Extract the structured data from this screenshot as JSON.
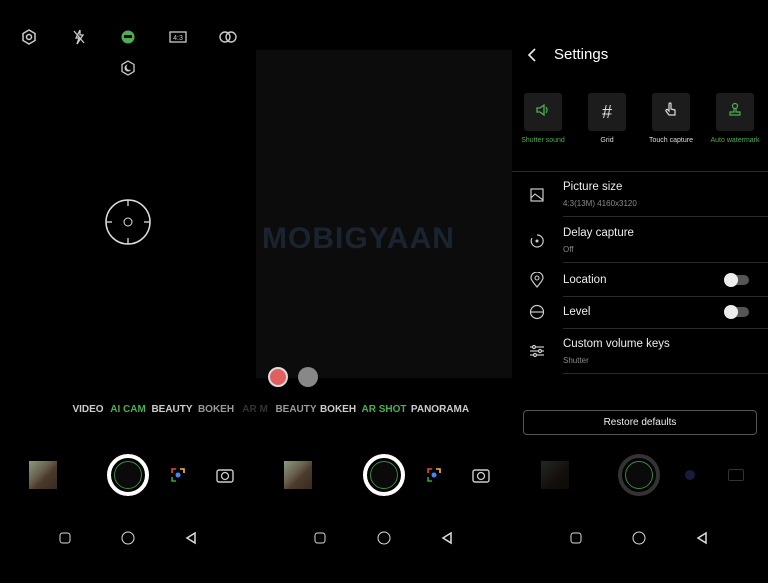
{
  "colors": {
    "accent": "#4caf50",
    "background": "#000000"
  },
  "watermark": "MOBIGYAAN",
  "top_icons": [
    "settings-icon",
    "flash-off-icon",
    "ai-scene-icon",
    "aspect-ratio-icon",
    "filter-icon",
    "night-mode-icon"
  ],
  "modes": [
    {
      "label": "VIDEO",
      "active": false
    },
    {
      "label": "AI CAM",
      "active": true
    },
    {
      "label": "BEAUTY",
      "active": false
    },
    {
      "label": "BOKEH",
      "active": false
    },
    {
      "label": "AR M",
      "active": false
    },
    {
      "label": "BEAUTY",
      "active": false
    },
    {
      "label": "BOKEH",
      "active": false
    },
    {
      "label": "AR SHOT",
      "active": true
    },
    {
      "label": "PANORAMA",
      "active": false
    }
  ],
  "settings": {
    "title": "Settings",
    "quick": [
      {
        "label": "Shutter sound",
        "icon": "speaker-icon",
        "on": true
      },
      {
        "label": "Grid",
        "icon": "grid-icon",
        "on": false
      },
      {
        "label": "Touch capture",
        "icon": "touch-icon",
        "on": false
      },
      {
        "label": "Auto watermark",
        "icon": "stamp-icon",
        "on": true
      }
    ],
    "rows": [
      {
        "title": "Picture size",
        "sub": "4:3(13M) 4160x3120"
      },
      {
        "title": "Delay capture",
        "sub": "Off"
      },
      {
        "title": "Location",
        "toggle": false
      },
      {
        "title": "Level",
        "toggle": false
      },
      {
        "title": "Custom volume keys",
        "sub": "Shutter"
      }
    ],
    "restore": "Restore defaults"
  }
}
